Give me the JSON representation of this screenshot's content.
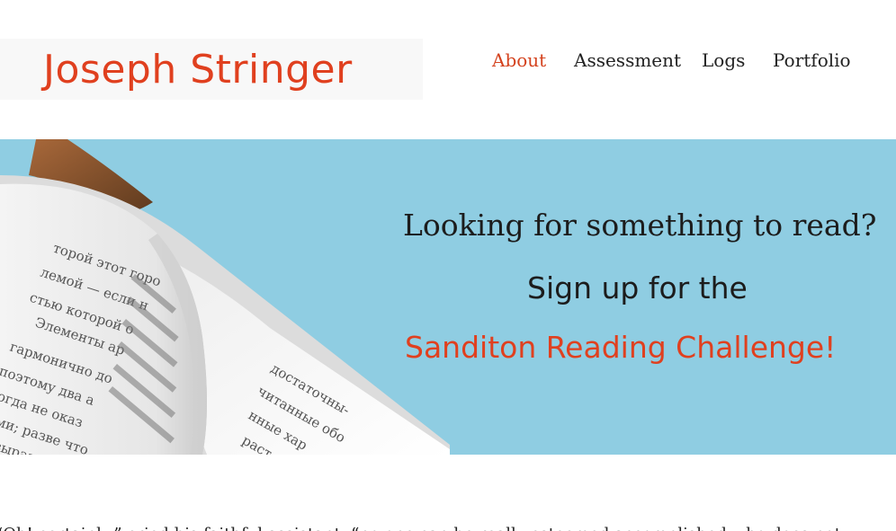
{
  "header": {
    "site_title": "Joseph Stringer",
    "nav": [
      {
        "label": "About",
        "active": true
      },
      {
        "label": "Assessment",
        "active": false
      },
      {
        "label": "Logs",
        "active": false
      },
      {
        "label": "Portfolio",
        "active": false
      }
    ]
  },
  "hero": {
    "line1": "Looking for something to read?",
    "line2": "Sign up for the",
    "line3": "Sanditon Reading Challenge!",
    "background_color": "#8fcde2",
    "accent_color": "#e0401f",
    "book_text": [
      "торой этот горо",
      "лемой — если н",
      "стью которой о",
      "Элементы ар",
      "гармонично до",
      "поэтому два а",
      "огда не оказ",
      "ми; разве что",
      "выразите",
      "достаточны-",
      "читанные обо",
      "нные хар",
      "раст"
    ]
  },
  "content": {
    "paragraph": "“Oh! certainly,” cried his faithful assistant, “no one can be really esteemed accomplished who does not"
  },
  "colors": {
    "brand_red": "#e0401f",
    "nav_active": "#d4431f",
    "text_dark": "#222222"
  }
}
